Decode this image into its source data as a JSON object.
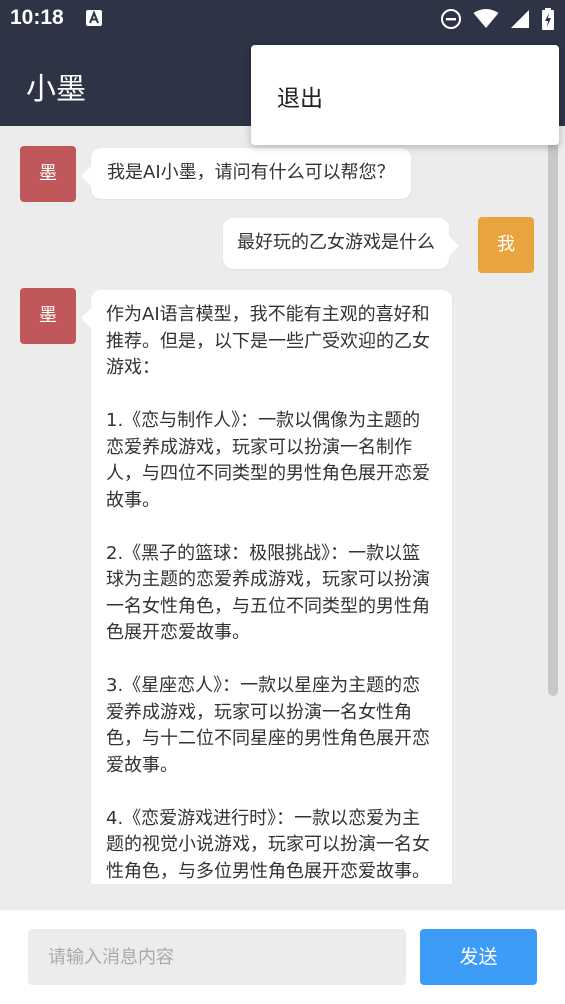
{
  "status_bar": {
    "time": "10:18",
    "icons": [
      "keyboard-a-icon",
      "do-not-disturb-icon",
      "wifi-icon",
      "cellular-signal-icon",
      "battery-charging-icon"
    ]
  },
  "app_bar": {
    "title": "小墨"
  },
  "menu": {
    "items": [
      {
        "label": "退出"
      }
    ]
  },
  "colors": {
    "app_bar": "#2e3346",
    "ai_avatar": "#c0575a",
    "user_avatar": "#e9a33f",
    "send_button": "#3d9cf5"
  },
  "messages": [
    {
      "sender": "ai",
      "avatar_label": "墨",
      "text": "我是AI小墨，请问有什么可以帮您？"
    },
    {
      "sender": "user",
      "avatar_label": "我",
      "text": "最好玩的乙女游戏是什么"
    },
    {
      "sender": "ai",
      "avatar_label": "墨",
      "paragraphs": [
        "作为AI语言模型，我不能有主观的喜好和推荐。但是，以下是一些广受欢迎的乙女游戏：",
        "1.《恋与制作人》：一款以偶像为主题的恋爱养成游戏，玩家可以扮演一名制作人，与四位不同类型的男性角色展开恋爱故事。",
        "2.《黑子的篮球：极限挑战》：一款以篮球为主题的恋爱养成游戏，玩家可以扮演一名女性角色，与五位不同类型的男性角色展开恋爱故事。",
        "3.《星座恋人》：一款以星座为主题的恋爱养成游戏，玩家可以扮演一名女性角色，与十二位不同星座的男性角色展开恋爱故事。",
        "4.《恋爱游戏进行时》：一款以恋爱为主题的视觉小说游戏，玩家可以扮演一名女性角色，与多位男性角色展开恋爱故事。"
      ]
    }
  ],
  "input": {
    "placeholder": "请输入消息内容",
    "value": ""
  },
  "send_button": {
    "label": "发送"
  }
}
